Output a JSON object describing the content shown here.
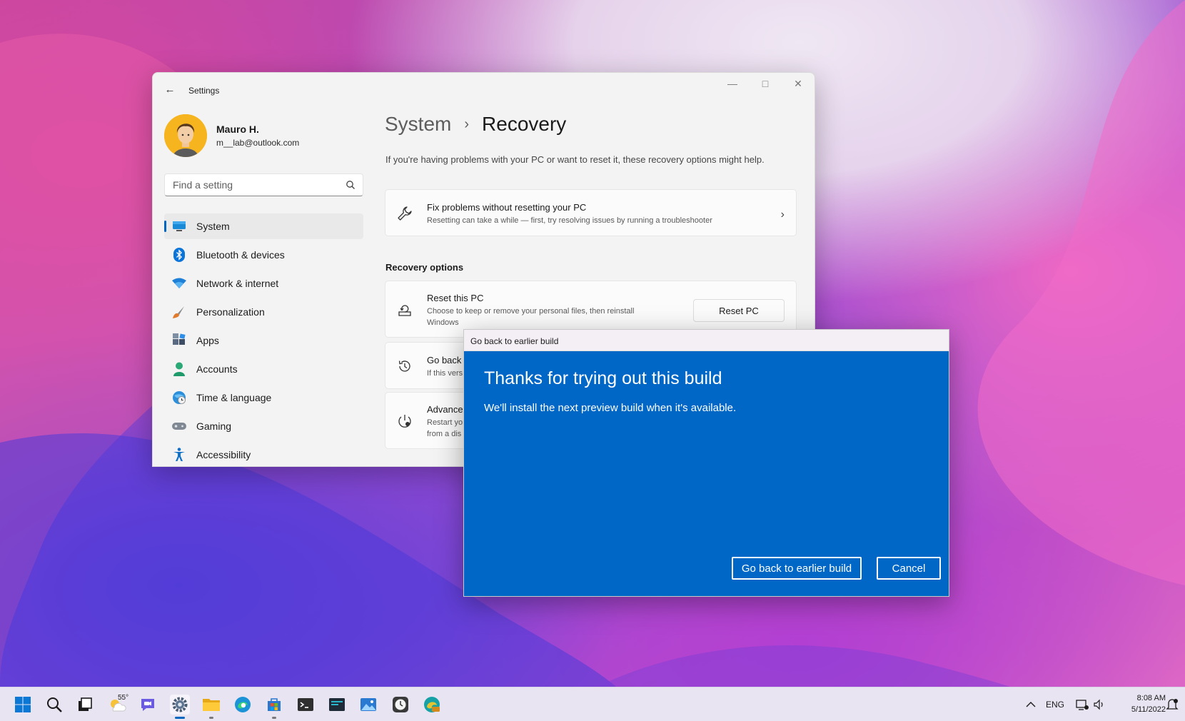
{
  "settings": {
    "app_title": "Settings",
    "window_controls": {
      "minimize": "minimize-icon",
      "maximize": "maximize-icon",
      "close": "close-icon"
    },
    "profile": {
      "name": "Mauro H.",
      "email": "m__lab@outlook.com"
    },
    "search": {
      "placeholder": "Find a setting"
    },
    "nav": [
      {
        "label": "System",
        "icon": "monitor-icon",
        "selected": true
      },
      {
        "label": "Bluetooth & devices",
        "icon": "bluetooth-icon",
        "selected": false
      },
      {
        "label": "Network & internet",
        "icon": "wifi-icon",
        "selected": false
      },
      {
        "label": "Personalization",
        "icon": "paintbrush-icon",
        "selected": false
      },
      {
        "label": "Apps",
        "icon": "apps-icon",
        "selected": false
      },
      {
        "label": "Accounts",
        "icon": "person-icon",
        "selected": false
      },
      {
        "label": "Time & language",
        "icon": "globe-clock-icon",
        "selected": false
      },
      {
        "label": "Gaming",
        "icon": "gamepad-icon",
        "selected": false
      },
      {
        "label": "Accessibility",
        "icon": "accessibility-icon",
        "selected": false
      }
    ],
    "breadcrumb": {
      "parent": "System",
      "separator": "›",
      "current": "Recovery"
    },
    "description": "If you're having problems with your PC or want to reset it, these recovery options might help.",
    "fix_card": {
      "title": "Fix problems without resetting your PC",
      "desc": "Resetting can take a while — first, try resolving issues by running a troubleshooter"
    },
    "recovery_options_label": "Recovery options",
    "reset_card": {
      "title": "Reset this PC",
      "desc_line1": "Choose to keep or remove your personal files, then reinstall",
      "desc_line2": "Windows",
      "button": "Reset PC"
    },
    "goback_card": {
      "title": "Go back",
      "desc": "If this vers"
    },
    "advanced_card": {
      "title": "Advance",
      "desc_line1": "Restart yo",
      "desc_line2": "from a dis"
    }
  },
  "dialog": {
    "title": "Go back to earlier build",
    "heading": "Thanks for trying out this build",
    "text": "We'll install the next preview build when it's available.",
    "primary_button": "Go back to earlier build",
    "cancel_button": "Cancel"
  },
  "taskbar": {
    "weather_temp": "55°",
    "language": "ENG",
    "time": "8:08 AM",
    "date": "5/11/2022"
  },
  "colors": {
    "accent": "#0067c0",
    "dialog_bg": "#0067c7",
    "window_bg": "#f3f3f3"
  }
}
